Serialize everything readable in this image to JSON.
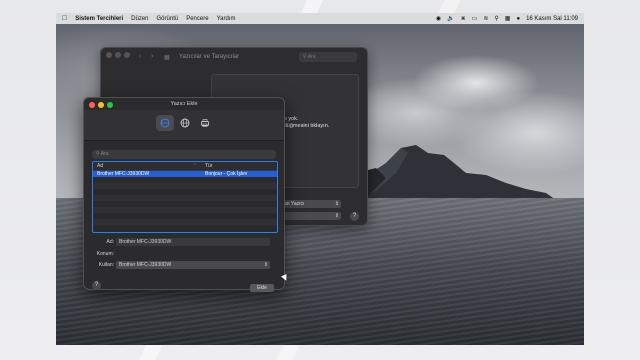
{
  "menubar": {
    "app_name": "Sistem Tercihleri",
    "menus": [
      "Düzen",
      "Görüntü",
      "Pencere",
      "Yardım"
    ],
    "clock": "16 Kasım Sal 11:09"
  },
  "back_window": {
    "title": "Yazıcılar ve Tarayıcılar",
    "search_placeholder": "Ara",
    "message_line1": "ıcı yok.",
    "message_line2": "i düğmesini tıklayın.",
    "select1_value": "an Yazıcı"
  },
  "dialog": {
    "title": "Yazıcı Ekle",
    "search_placeholder": "Ara",
    "columns": {
      "name": "Ad",
      "type": "Tür"
    },
    "rows": [
      {
        "name": "Brother MFC-J3930DW",
        "type": "Bonjour - Çok İşlev"
      }
    ],
    "labels": {
      "name": "Ad:",
      "location": "Konum:",
      "use": "Kullan:"
    },
    "name_value": "Brother MFC-J3930DW",
    "location_value": "",
    "use_value": "Brother MFC-J3930DW",
    "add_label": "Ekle",
    "help_label": "?"
  },
  "colors": {
    "accent": "#2160d9",
    "focus_ring": "#2f7df6",
    "close": "#ff5f57",
    "minimize": "#febc2e",
    "zoom": "#28c840"
  }
}
